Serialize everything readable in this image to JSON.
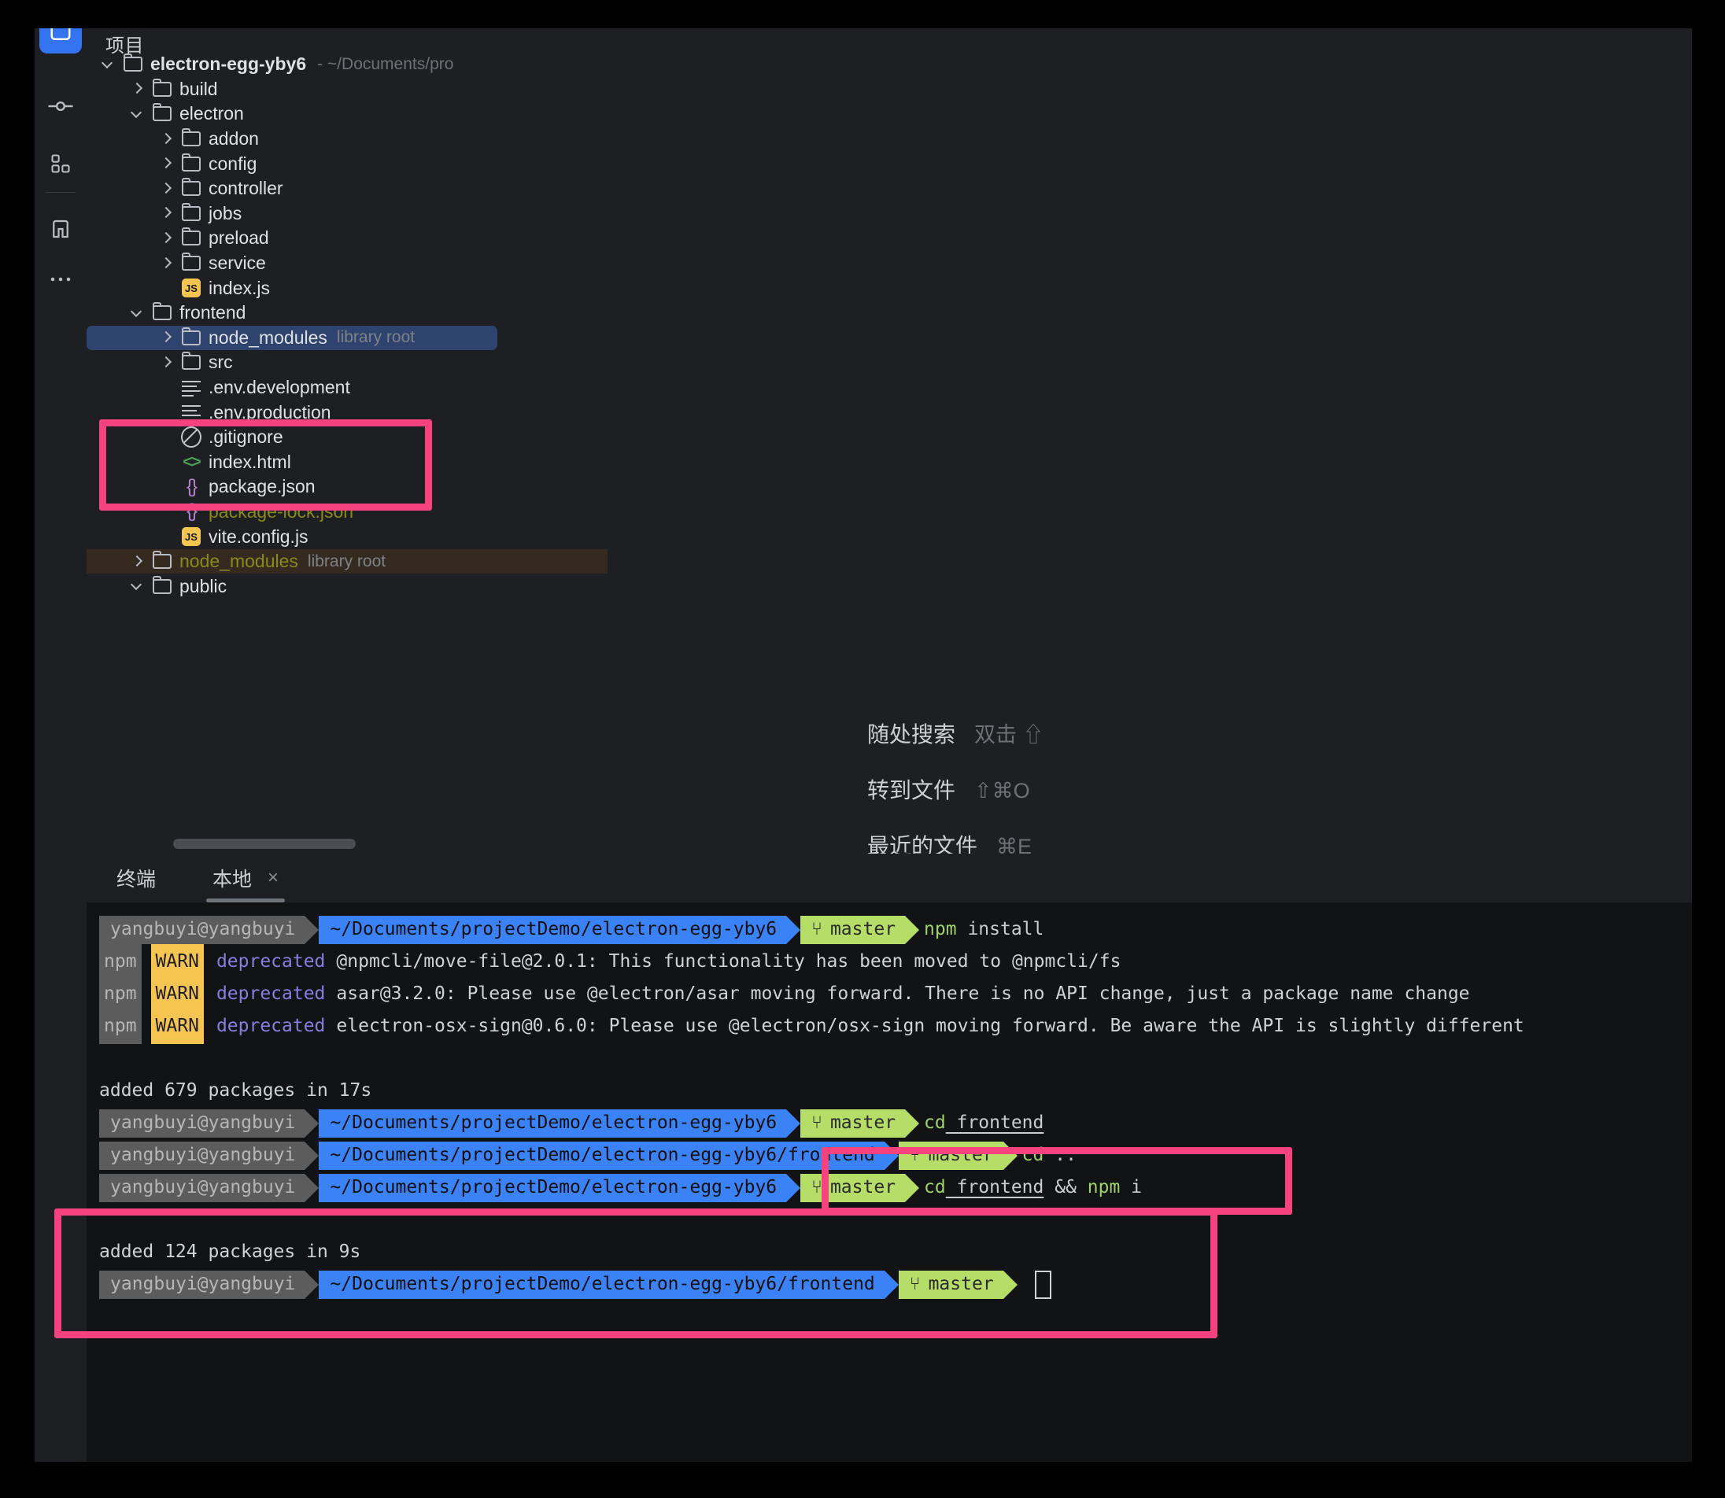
{
  "rail": {
    "items": [
      {
        "name": "project-view-icon",
        "glyph": "folder-tab",
        "active": true
      },
      {
        "name": "commit-icon",
        "glyph": "commit",
        "active": false
      },
      {
        "name": "structure-icon",
        "glyph": "grid",
        "active": false
      },
      {
        "name": "notifications-icon",
        "glyph": "bell-n",
        "active": false
      },
      {
        "name": "more-tool-windows-icon",
        "glyph": "ellipsis",
        "active": false
      }
    ]
  },
  "project_panel": {
    "title": "项目",
    "root": {
      "label": "electron-egg-yby6",
      "path": "- ~/Documents/pro"
    },
    "tree": [
      {
        "label": "build",
        "kind": "folder",
        "indent": 1,
        "state": "collapsed"
      },
      {
        "label": "electron",
        "kind": "folder",
        "indent": 1,
        "state": "expanded"
      },
      {
        "label": "addon",
        "kind": "folder",
        "indent": 2,
        "state": "collapsed"
      },
      {
        "label": "config",
        "kind": "folder",
        "indent": 2,
        "state": "collapsed"
      },
      {
        "label": "controller",
        "kind": "folder",
        "indent": 2,
        "state": "collapsed"
      },
      {
        "label": "jobs",
        "kind": "folder",
        "indent": 2,
        "state": "collapsed"
      },
      {
        "label": "preload",
        "kind": "folder",
        "indent": 2,
        "state": "collapsed"
      },
      {
        "label": "service",
        "kind": "folder",
        "indent": 2,
        "state": "collapsed"
      },
      {
        "label": "index.js",
        "kind": "js",
        "indent": 2,
        "state": "leaf"
      },
      {
        "label": "frontend",
        "kind": "folder",
        "indent": 1,
        "state": "expanded"
      },
      {
        "label": "node_modules",
        "hint": "library root",
        "kind": "folder",
        "indent": 2,
        "state": "collapsed",
        "selected": "blue"
      },
      {
        "label": "src",
        "kind": "folder",
        "indent": 2,
        "state": "collapsed"
      },
      {
        "label": ".env.development",
        "kind": "lines",
        "indent": 2,
        "state": "leaf"
      },
      {
        "label": ".env.production",
        "kind": "lines",
        "indent": 2,
        "state": "leaf"
      },
      {
        "label": ".gitignore",
        "kind": "ignore",
        "indent": 2,
        "state": "leaf"
      },
      {
        "label": "index.html",
        "kind": "html",
        "indent": 2,
        "state": "leaf"
      },
      {
        "label": "package.json",
        "kind": "json",
        "indent": 2,
        "state": "leaf"
      },
      {
        "label": "package-lock.json",
        "kind": "json",
        "indent": 2,
        "state": "leaf",
        "color": "yellow"
      },
      {
        "label": "vite.config.js",
        "kind": "js",
        "indent": 2,
        "state": "leaf"
      },
      {
        "label": "node_modules",
        "hint": "library root",
        "kind": "folder",
        "indent": 1,
        "state": "collapsed",
        "selected": "brown",
        "color": "yellow"
      },
      {
        "label": "public",
        "kind": "folder",
        "indent": 1,
        "state": "expanded"
      }
    ]
  },
  "editor_hints": [
    {
      "label": "随处搜索",
      "keys": "双击 ⇧"
    },
    {
      "label": "转到文件",
      "keys": "⇧⌘O"
    },
    {
      "label": "最近的文件",
      "keys": "⌘E"
    }
  ],
  "terminal": {
    "tabs": [
      {
        "label": "终端",
        "active": false,
        "closable": false
      },
      {
        "label": "本地",
        "active": true,
        "closable": true,
        "close_glyph": "×"
      }
    ],
    "user": "yangbuyi@yangbuyi",
    "branch": "master",
    "branch_glyph": "⑂",
    "lines": [
      {
        "type": "prompt",
        "user": "yangbuyi@yangbuyi",
        "path": "~/Documents/projectDemo/electron-egg-yby6",
        "branch": "master",
        "cmd_green": "npm",
        "cmd_rest": " install"
      },
      {
        "type": "npmwarn",
        "tag": "npm",
        "warn": "WARN",
        "word": "deprecated",
        "msg": "@npmcli/move-file@2.0.1: This functionality has been moved to @npmcli/fs"
      },
      {
        "type": "npmwarn",
        "tag": "npm",
        "warn": "WARN",
        "word": "deprecated",
        "msg": "asar@3.2.0: Please use @electron/asar moving forward.  There is no API change, just a package name change"
      },
      {
        "type": "npmwarn",
        "tag": "npm",
        "warn": "WARN",
        "word": "deprecated",
        "msg": "electron-osx-sign@0.6.0: Please use @electron/osx-sign moving forward. Be aware the API is slightly different"
      },
      {
        "type": "blank"
      },
      {
        "type": "plain",
        "text": "added 679 packages in 17s"
      },
      {
        "type": "prompt",
        "user": "yangbuyi@yangbuyi",
        "path": "~/Documents/projectDemo/electron-egg-yby6",
        "branch": "master",
        "cmd_green": "cd",
        "cmd_under": "frontend"
      },
      {
        "type": "prompt",
        "user": "yangbuyi@yangbuyi",
        "path": "~/Documents/projectDemo/electron-egg-yby6/frontend",
        "branch": "master",
        "cmd_green": "cd",
        "cmd_rest": " .."
      },
      {
        "type": "prompt",
        "user": "yangbuyi@yangbuyi",
        "path": "~/Documents/projectDemo/electron-egg-yby6",
        "branch": "master",
        "cmd_green": "cd",
        "cmd_under": "frontend",
        "cmd_tail": " && ",
        "cmd_green2": "npm",
        "cmd_tail2": " i"
      },
      {
        "type": "blank"
      },
      {
        "type": "plain",
        "text": "added 124 packages in 9s"
      },
      {
        "type": "prompt-cursor",
        "user": "yangbuyi@yangbuyi",
        "path": "~/Documents/projectDemo/electron-egg-yby6/frontend",
        "branch": "master"
      }
    ]
  },
  "annotations": {
    "color": "#f6427f",
    "boxes": [
      {
        "name": "highlight-frontend-folder"
      },
      {
        "name": "highlight-cd-frontend-npm-i-command"
      },
      {
        "name": "highlight-install-result"
      }
    ]
  }
}
